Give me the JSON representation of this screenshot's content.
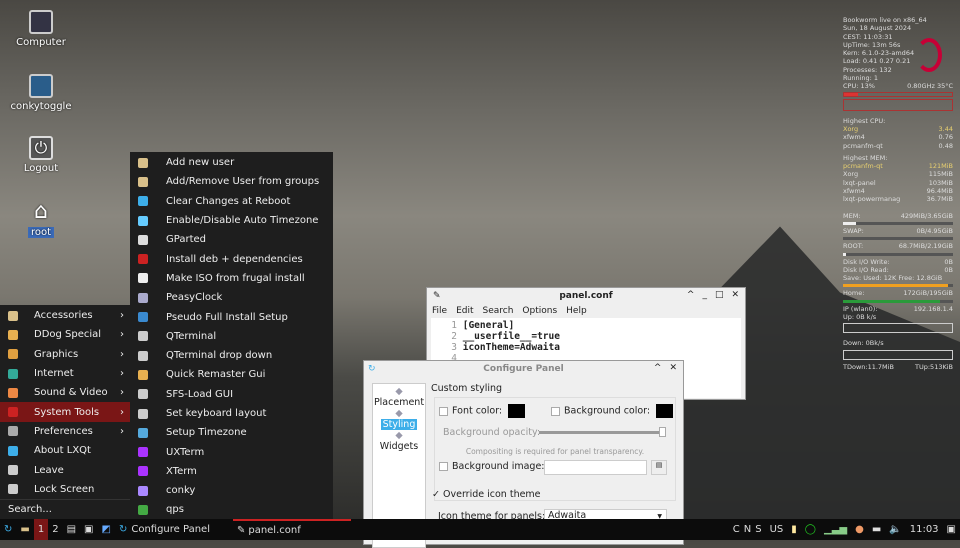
{
  "desktop": {
    "icons": [
      {
        "label": "Computer"
      },
      {
        "label": "conkytoggle"
      },
      {
        "label": "Logout"
      },
      {
        "label": "root"
      }
    ]
  },
  "main_menu": {
    "items": [
      {
        "label": "Accessories",
        "icon": "accessories-icon",
        "submenu": true
      },
      {
        "label": "DDog Special",
        "icon": "folder-icon",
        "submenu": true
      },
      {
        "label": "Graphics",
        "icon": "graphics-icon",
        "submenu": true
      },
      {
        "label": "Internet",
        "icon": "globe-icon",
        "submenu": true
      },
      {
        "label": "Sound & Video",
        "icon": "media-icon",
        "submenu": true
      },
      {
        "label": "System Tools",
        "icon": "gear-icon",
        "submenu": true,
        "selected": true
      },
      {
        "label": "Preferences",
        "icon": "preferences-icon",
        "submenu": true
      },
      {
        "label": "About LXQt",
        "icon": "info-icon"
      },
      {
        "label": "Leave",
        "icon": "leave-icon"
      },
      {
        "label": "Lock Screen",
        "icon": "lock-icon"
      }
    ],
    "search_placeholder": "Search..."
  },
  "submenu": {
    "items": [
      "Add new user",
      "Add/Remove User from groups",
      "Clear Changes at Reboot",
      "Enable/Disable Auto Timezone",
      "GParted",
      "Install deb + dependencies",
      "Make ISO from frugal install",
      "PeasyClock",
      "Pseudo Full Install Setup",
      "QTerminal",
      "QTerminal drop down",
      "Quick Remaster Gui",
      "SFS-Load GUI",
      "Set keyboard layout",
      "Setup Timezone",
      "UXTerm",
      "XTerm",
      "conky",
      "qps"
    ]
  },
  "taskbar": {
    "desktops": [
      "1",
      "2"
    ],
    "tasks": [
      "Configure Panel",
      "panel.conf"
    ],
    "keyboard": [
      "C",
      "N",
      "S"
    ],
    "layout": "US",
    "clock": "11:03"
  },
  "editor": {
    "title": "panel.conf",
    "menu": [
      "File",
      "Edit",
      "Search",
      "Options",
      "Help"
    ],
    "lines": [
      {
        "n": "1",
        "text": "[General]"
      },
      {
        "n": "2",
        "text": "__userfile__=true"
      },
      {
        "n": "3",
        "text": "iconTheme=Adwaita"
      },
      {
        "n": "4",
        "text": ""
      }
    ]
  },
  "config_panel": {
    "title": "Configure Panel",
    "nav": [
      "Placement",
      "Styling",
      "Widgets"
    ],
    "selected_nav": "Styling",
    "section": "Custom styling",
    "font_color": "Font color:",
    "bg_color": "Background color:",
    "bg_opacity": "Background opacity:",
    "opacity_value": 100,
    "compositing_note": "Compositing is required for panel transparency.",
    "bg_image": "Background image:",
    "override": "Override icon theme",
    "override_checked": true,
    "icon_theme_label": "Icon theme for panels:",
    "icon_theme_value": "Adwaita"
  },
  "conky": {
    "header": "Bookworm live on x86_64",
    "date": "Sun, 18 August 2024",
    "time_label": "CEST:",
    "time": "11:03:31",
    "uptime": "UpTime: 13m 56s",
    "kernel": "Kern: 6.1.0-23-amd64",
    "load": "Load: 0.41 0.27 0.21",
    "processes": "Processes: 132",
    "running": "Running: 1",
    "cpu": "CPU: 13%",
    "cpu_freq": "0.80GHz 35°C",
    "cpu_pct": 13,
    "highest_cpu_title": "Highest CPU:",
    "highest_cpu": [
      [
        "Xorg",
        "3.44"
      ],
      [
        "xfwm4",
        "0.76"
      ],
      [
        "pcmanfm-qt",
        "0.48"
      ]
    ],
    "highest_mem_title": "Highest MEM:",
    "highest_mem": [
      [
        "pcmanfm-qt",
        "121MiB"
      ],
      [
        "Xorg",
        "115MiB"
      ],
      [
        "lxqt-panel",
        "103MiB"
      ],
      [
        "xfwm4",
        "96.4MiB"
      ],
      [
        "lxqt-powermanag",
        "36.7MiB"
      ]
    ],
    "mem": [
      "MEM:",
      "429MiB/3.65GiB"
    ],
    "mem_pct": 12,
    "swap": [
      "SWAP:",
      "0B/4.95GiB"
    ],
    "swap_pct": 0,
    "root": [
      "ROOT:",
      "68.7MiB/2.19GiB"
    ],
    "root_pct": 3,
    "disk_write": [
      "Disk I/O Write:",
      "0B"
    ],
    "disk_read": [
      "Disk I/O Read:",
      "0B"
    ],
    "save": "Save: Used: 12K Free: 12.8GiB",
    "save_pct": 95,
    "home": [
      "Home:",
      "172GiB/195GiB"
    ],
    "home_pct": 88,
    "ip": [
      "IP (wlan0):",
      "192.168.1.4"
    ],
    "up": "Up: 0B k/s",
    "down": "Down: 0Bk/s",
    "tdown": "TDown:11.7MiB",
    "tup": "TUp:513KiB"
  },
  "colors": {
    "menu_highlight": "#7a1616",
    "debian_red": "#c70036",
    "selection": "#3daee9"
  }
}
